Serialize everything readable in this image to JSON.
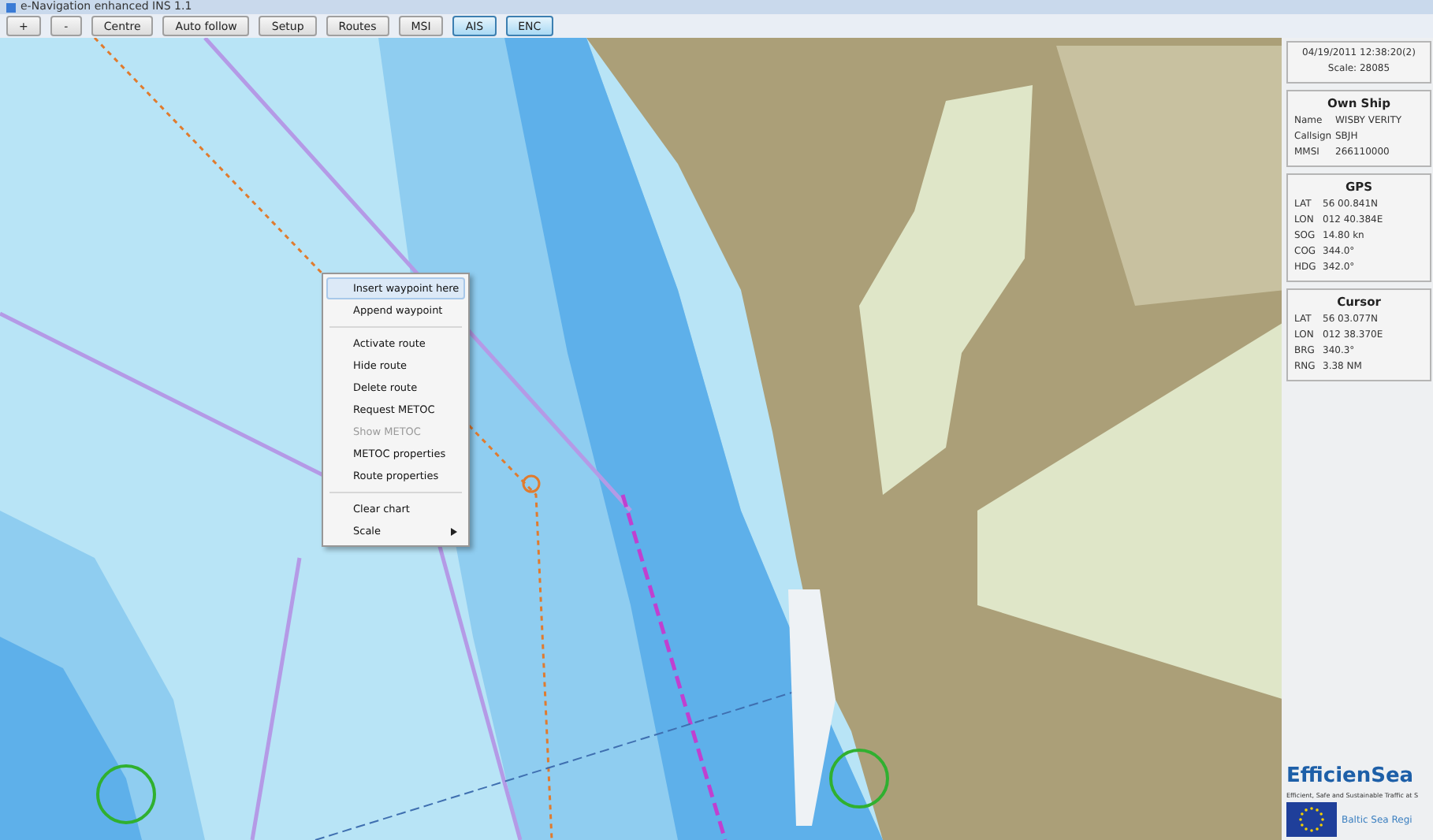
{
  "window": {
    "title": "e-Navigation enhanced INS 1.1"
  },
  "toolbar": [
    {
      "label": "+",
      "selected": false
    },
    {
      "label": "-",
      "selected": false
    },
    {
      "label": "Centre",
      "selected": false
    },
    {
      "label": "Auto follow",
      "selected": false
    },
    {
      "label": "Setup",
      "selected": false
    },
    {
      "label": "Routes",
      "selected": false
    },
    {
      "label": "MSI",
      "selected": false
    },
    {
      "label": "AIS",
      "selected": true
    },
    {
      "label": "ENC",
      "selected": true
    }
  ],
  "context_menu": {
    "groups": [
      [
        {
          "kind": "item",
          "label": "Insert waypoint here",
          "selected": true,
          "disabled": false
        },
        {
          "kind": "item",
          "label": "Append waypoint",
          "selected": false,
          "disabled": false
        }
      ],
      [
        {
          "kind": "item",
          "label": "Activate route",
          "selected": false,
          "disabled": false
        },
        {
          "kind": "item",
          "label": "Hide route",
          "selected": false,
          "disabled": false
        },
        {
          "kind": "item",
          "label": "Delete route",
          "selected": false,
          "disabled": false
        },
        {
          "kind": "item",
          "label": "Request METOC",
          "selected": false,
          "disabled": false
        },
        {
          "kind": "item",
          "label": "Show METOC",
          "selected": false,
          "disabled": true
        },
        {
          "kind": "item",
          "label": "METOC properties",
          "selected": false,
          "disabled": false
        },
        {
          "kind": "item",
          "label": "Route properties",
          "selected": false,
          "disabled": false
        }
      ],
      [
        {
          "kind": "item",
          "label": "Clear chart",
          "selected": false,
          "disabled": false
        },
        {
          "kind": "submenu",
          "label": "Scale",
          "selected": false,
          "disabled": false
        }
      ]
    ]
  },
  "sidebar": {
    "status": {
      "datetime": "04/19/2011 12:38:20(2)",
      "scale": "Scale: 28085"
    },
    "panels": [
      {
        "title": "Own Ship",
        "rows": [
          {
            "label": "Name",
            "value": "WISBY VERITY"
          },
          {
            "label": "Callsign",
            "value": "SBJH"
          },
          {
            "label": "MMSI",
            "value": "266110000"
          }
        ]
      },
      {
        "title": "GPS",
        "rows": [
          {
            "label": "LAT",
            "value": "56 00.841N"
          },
          {
            "label": "LON",
            "value": "012 40.384E"
          },
          {
            "label": "SOG",
            "value": "14.80 kn"
          },
          {
            "label": "COG",
            "value": "344.0°"
          },
          {
            "label": "HDG",
            "value": "342.0°"
          }
        ]
      },
      {
        "title": "Cursor",
        "rows": [
          {
            "label": "LAT",
            "value": "56 03.077N"
          },
          {
            "label": "LON",
            "value": "012 38.370E"
          },
          {
            "label": "BRG",
            "value": "340.3°"
          },
          {
            "label": "RNG",
            "value": "3.38 NM"
          }
        ]
      }
    ],
    "logo": {
      "name": "EfficienSea",
      "tagline": "Efficient, Safe and Sustainable Traffic at S",
      "programme": "Baltic Sea Regi"
    }
  }
}
